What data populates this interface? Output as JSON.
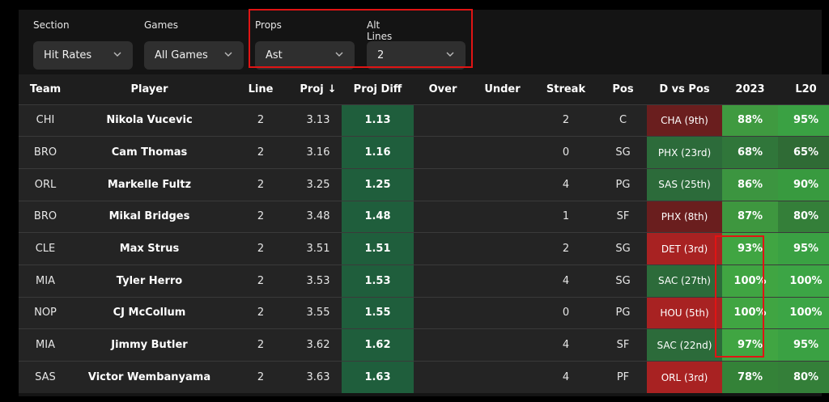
{
  "filters": {
    "section": {
      "label": "Section",
      "value": "Hit Rates"
    },
    "games": {
      "label": "Games",
      "value": "All Games"
    },
    "props": {
      "label": "Props",
      "value": "Ast"
    },
    "alt_lines": {
      "label": "Alt Lines",
      "value": "2"
    }
  },
  "table": {
    "headers": {
      "team": "Team",
      "player": "Player",
      "line": "Line",
      "proj": "Proj",
      "proj_sort_icon": "↓",
      "proj_diff": "Proj Diff",
      "over": "Over",
      "under": "Under",
      "streak": "Streak",
      "pos": "Pos",
      "d_vs_pos": "D vs Pos",
      "y2023": "2023",
      "l20": "L20"
    },
    "rows": [
      {
        "team": "CHI",
        "player": "Nikola Vucevic",
        "line": "2",
        "proj": "3.13",
        "proj_diff": "1.13",
        "over": "",
        "under": "",
        "streak": "2",
        "pos": "C",
        "d_vs_pos": "CHA (9th)",
        "y2023": "88%",
        "l20": "95%"
      },
      {
        "team": "BRO",
        "player": "Cam Thomas",
        "line": "2",
        "proj": "3.16",
        "proj_diff": "1.16",
        "over": "",
        "under": "",
        "streak": "0",
        "pos": "SG",
        "d_vs_pos": "PHX (23rd)",
        "y2023": "68%",
        "l20": "65%"
      },
      {
        "team": "ORL",
        "player": "Markelle Fultz",
        "line": "2",
        "proj": "3.25",
        "proj_diff": "1.25",
        "over": "",
        "under": "",
        "streak": "4",
        "pos": "PG",
        "d_vs_pos": "SAS (25th)",
        "y2023": "86%",
        "l20": "90%"
      },
      {
        "team": "BRO",
        "player": "Mikal Bridges",
        "line": "2",
        "proj": "3.48",
        "proj_diff": "1.48",
        "over": "",
        "under": "",
        "streak": "1",
        "pos": "SF",
        "d_vs_pos": "PHX (8th)",
        "y2023": "87%",
        "l20": "80%"
      },
      {
        "team": "CLE",
        "player": "Max Strus",
        "line": "2",
        "proj": "3.51",
        "proj_diff": "1.51",
        "over": "",
        "under": "",
        "streak": "2",
        "pos": "SG",
        "d_vs_pos": "DET (3rd)",
        "y2023": "93%",
        "l20": "95%"
      },
      {
        "team": "MIA",
        "player": "Tyler Herro",
        "line": "2",
        "proj": "3.53",
        "proj_diff": "1.53",
        "over": "",
        "under": "",
        "streak": "4",
        "pos": "SG",
        "d_vs_pos": "SAC (27th)",
        "y2023": "100%",
        "l20": "100%"
      },
      {
        "team": "NOP",
        "player": "CJ McCollum",
        "line": "2",
        "proj": "3.55",
        "proj_diff": "1.55",
        "over": "",
        "under": "",
        "streak": "0",
        "pos": "PG",
        "d_vs_pos": "HOU (5th)",
        "y2023": "100%",
        "l20": "100%"
      },
      {
        "team": "MIA",
        "player": "Jimmy Butler",
        "line": "2",
        "proj": "3.62",
        "proj_diff": "1.62",
        "over": "",
        "under": "",
        "streak": "4",
        "pos": "SF",
        "d_vs_pos": "SAC (22nd)",
        "y2023": "97%",
        "l20": "95%"
      },
      {
        "team": "SAS",
        "player": "Victor Wembanyama",
        "line": "2",
        "proj": "3.63",
        "proj_diff": "1.63",
        "over": "",
        "under": "",
        "streak": "4",
        "pos": "PF",
        "d_vs_pos": "ORL (3rd)",
        "y2023": "78%",
        "l20": "80%"
      }
    ]
  },
  "colors": {
    "highlight": "#e01414",
    "proj_diff_bg": "#1f5e3c",
    "d_vs_pos_bg": [
      "#6a1e1e",
      "#2c6b3a",
      "#2c6b3a",
      "#6a1e1e",
      "#a82222",
      "#2c6b3a",
      "#a82222",
      "#2c6b3a",
      "#a82222"
    ],
    "y2023_bg": [
      "#3f9a40",
      "#30763a",
      "#3c9540",
      "#3e973f",
      "#40a542",
      "#40a542",
      "#40a542",
      "#40a542",
      "#348238"
    ],
    "l20_bg": [
      "#3aa143",
      "#2f6b35",
      "#389a3f",
      "#347f39",
      "#3aa143",
      "#3ca545",
      "#3ca545",
      "#3aa143",
      "#347f39"
    ]
  }
}
